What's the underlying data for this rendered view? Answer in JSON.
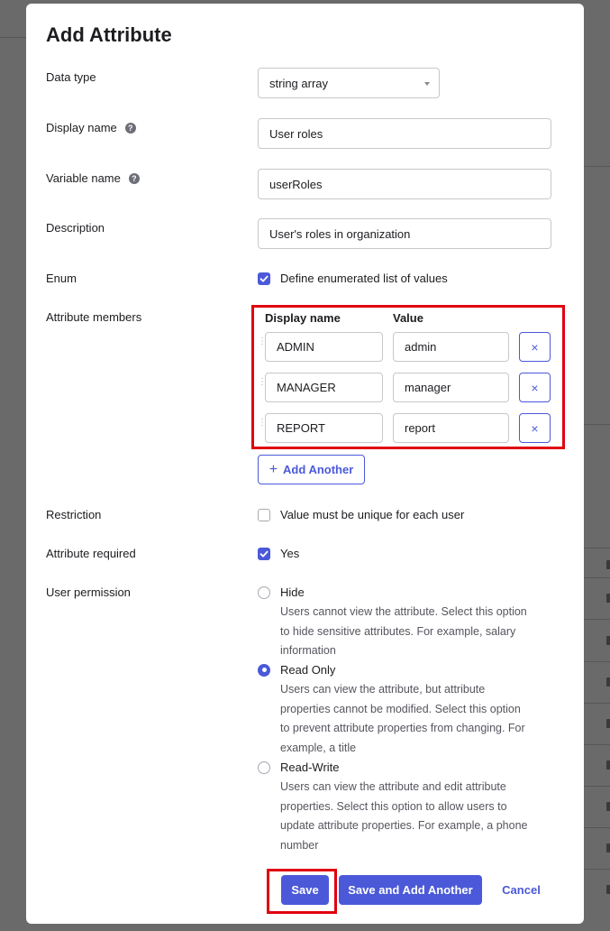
{
  "modal": {
    "title": "Add Attribute"
  },
  "form": {
    "data_type": {
      "label": "Data type",
      "value": "string array"
    },
    "display_name": {
      "label": "Display name",
      "value": "User roles",
      "help_icon": "?"
    },
    "variable_name": {
      "label": "Variable name",
      "value": "userRoles",
      "help_icon": "?"
    },
    "description": {
      "label": "Description",
      "value": "User's roles in organization"
    },
    "enum": {
      "label": "Enum",
      "checkbox_label": "Define enumerated list of values",
      "checked": true
    },
    "attribute_members": {
      "label": "Attribute members",
      "col_display_name": "Display name",
      "col_value": "Value",
      "rows": [
        {
          "display_name": "ADMIN",
          "value": "admin",
          "remove_label": "×"
        },
        {
          "display_name": "MANAGER",
          "value": "manager",
          "remove_label": "×"
        },
        {
          "display_name": "REPORT",
          "value": "report",
          "remove_label": "×"
        }
      ],
      "add_another_label": "Add Another",
      "add_icon": "+"
    },
    "restriction": {
      "label": "Restriction",
      "checkbox_label": "Value must be unique for each user",
      "checked": false
    },
    "attribute_required": {
      "label": "Attribute required",
      "checkbox_label": "Yes",
      "checked": true
    },
    "user_permission": {
      "label": "User permission",
      "options": [
        {
          "label": "Hide",
          "selected": false,
          "lines": [
            "Users cannot view the attribute. Select this option",
            "to hide sensitive attributes. For example, salary",
            "information"
          ]
        },
        {
          "label": "Read Only",
          "selected": true,
          "lines": [
            "Users can view the attribute, but attribute",
            "properties cannot be modified. Select this option",
            "to prevent attribute properties from changing. For",
            "example, a title"
          ]
        },
        {
          "label": "Read-Write",
          "selected": false,
          "lines": [
            "Users can view the attribute and edit attribute",
            "properties. Select this option to allow users to",
            "update attribute properties. For example, a phone",
            "number"
          ]
        }
      ]
    }
  },
  "footer": {
    "save_label": "Save",
    "save_add_label": "Save and Add Another",
    "cancel_label": "Cancel"
  },
  "colors": {
    "accent": "#4b59d8",
    "highlight": "#e0000f"
  },
  "icons": {
    "help": "help-circle-icon",
    "remove": "close-icon",
    "add": "plus-icon",
    "check": "check-icon",
    "dropdown": "caret-down-icon"
  }
}
